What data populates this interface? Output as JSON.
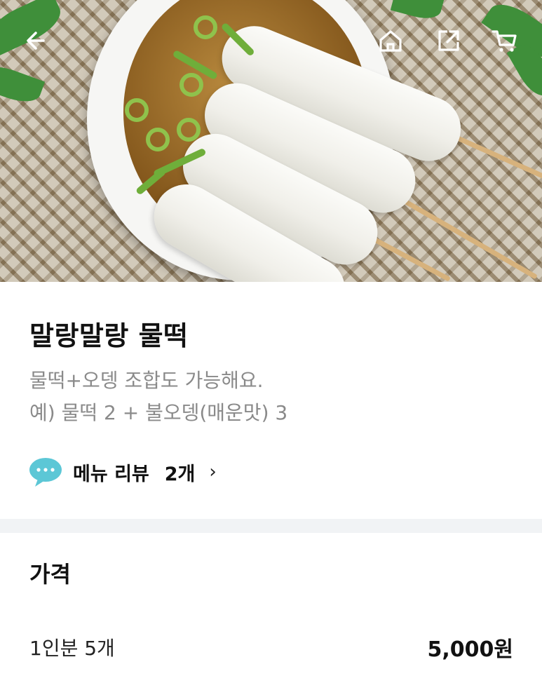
{
  "header": {
    "back_icon": "arrow-left-icon",
    "home_icon": "home-icon",
    "share_icon": "share-icon",
    "cart_icon": "cart-icon"
  },
  "product": {
    "name": "말랑말랑 물떡",
    "description_lines": [
      "물떡+오뎅 조합도 가능해요.",
      "예) 물떡 2 + 불오뎅(매운맛) 3"
    ]
  },
  "review": {
    "icon": "speech-bubble-icon",
    "label": "메뉴 리뷰",
    "count": "2개",
    "chevron": "›"
  },
  "price": {
    "heading": "가격",
    "options": [
      {
        "name": "1인분 5개",
        "price": "5,000원"
      }
    ]
  },
  "colors": {
    "review_icon": "#5cc7d6",
    "divider": "#f1f3f5",
    "description": "#8a8a8a"
  }
}
